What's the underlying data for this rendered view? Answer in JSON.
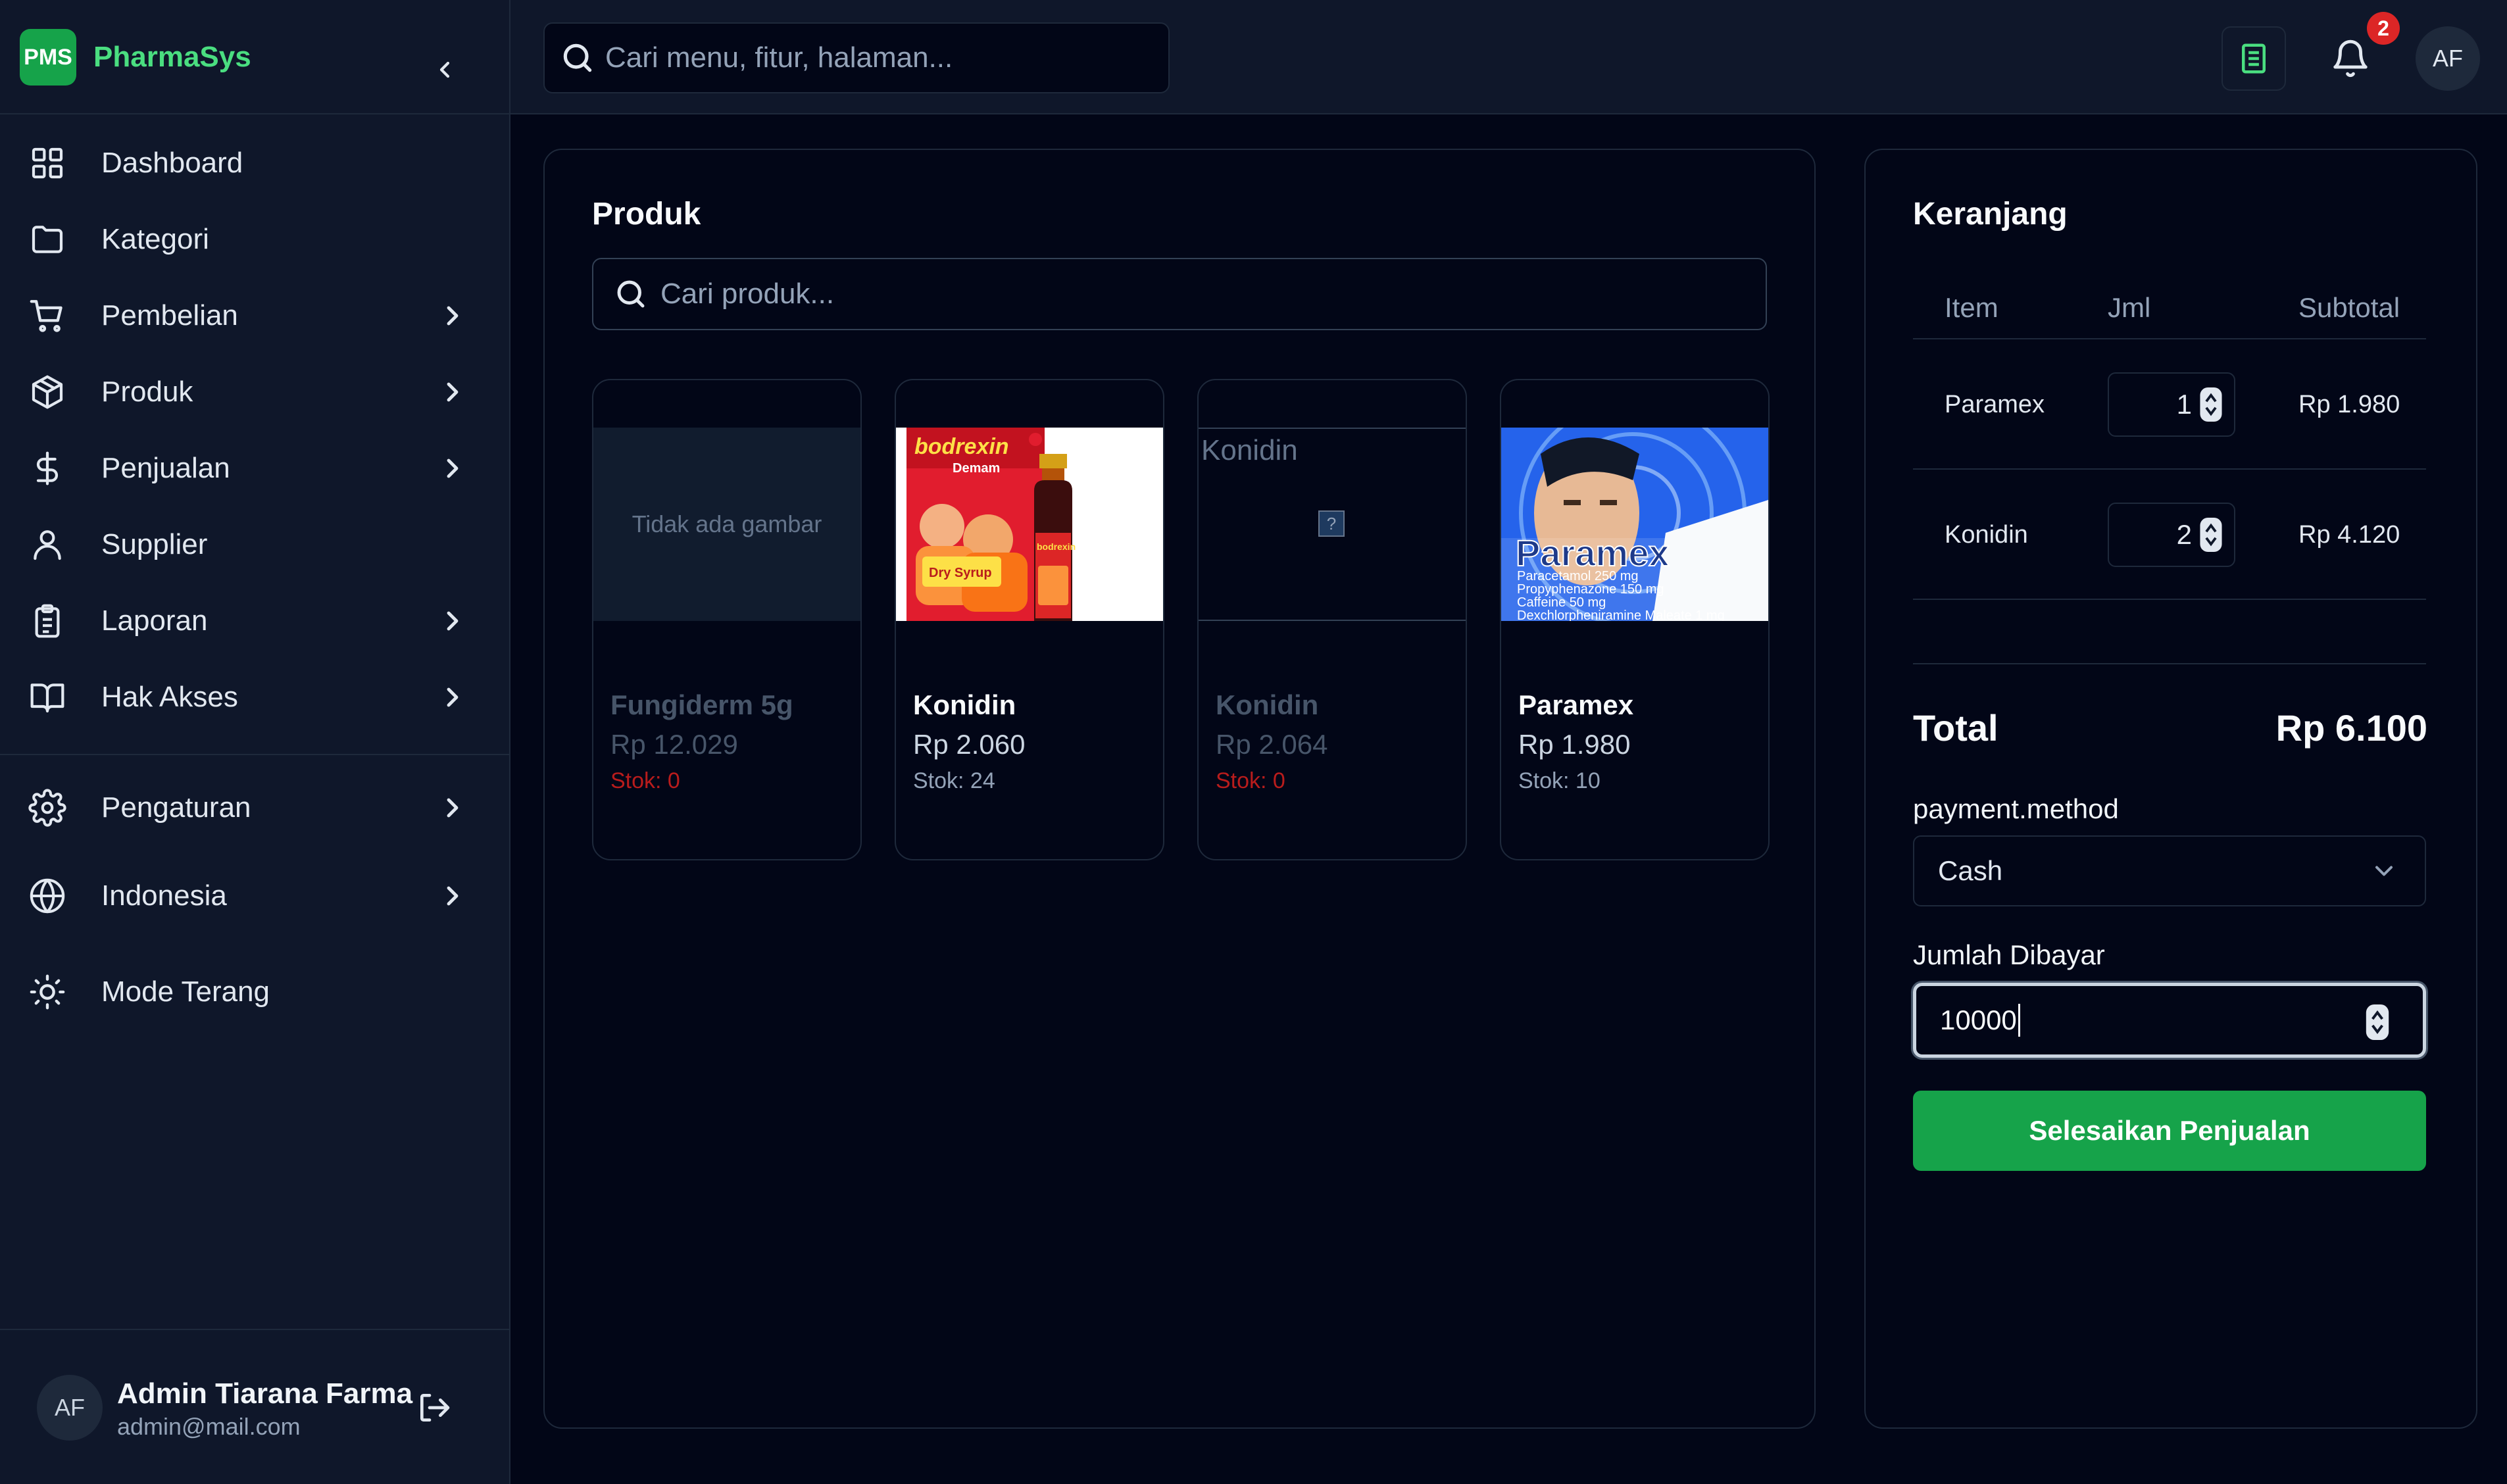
{
  "brand": {
    "logo": "PMS",
    "name": "PharmaSys"
  },
  "sidebar": {
    "items": [
      {
        "label": "Dashboard",
        "icon": "grid-icon",
        "has_submenu": false
      },
      {
        "label": "Kategori",
        "icon": "folder-icon",
        "has_submenu": false
      },
      {
        "label": "Pembelian",
        "icon": "cart-icon",
        "has_submenu": true
      },
      {
        "label": "Produk",
        "icon": "box-icon",
        "has_submenu": true
      },
      {
        "label": "Penjualan",
        "icon": "dollar-icon",
        "has_submenu": true
      },
      {
        "label": "Supplier",
        "icon": "user-icon",
        "has_submenu": false
      },
      {
        "label": "Laporan",
        "icon": "clipboard-icon",
        "has_submenu": true
      },
      {
        "label": "Hak Akses",
        "icon": "book-icon",
        "has_submenu": true
      }
    ],
    "settings": [
      {
        "label": "Pengaturan",
        "icon": "gear-icon",
        "has_submenu": true
      },
      {
        "label": "Indonesia",
        "icon": "globe-icon",
        "has_submenu": true
      },
      {
        "label": "Mode Terang",
        "icon": "sun-icon",
        "has_submenu": false
      }
    ],
    "user": {
      "initials": "AF",
      "name": "Admin Tiarana Farma",
      "email": "admin@mail.com"
    }
  },
  "topbar": {
    "search_placeholder": "Cari menu, fitur, halaman...",
    "notification_count": "2",
    "avatar_initials": "AF"
  },
  "products": {
    "title": "Produk",
    "search_placeholder": "Cari produk...",
    "items": [
      {
        "name": "Fungiderm 5g",
        "price": "Rp 12.029",
        "stock": "Stok: 0",
        "image": "none",
        "image_text": "Tidak ada gambar",
        "available": false
      },
      {
        "name": "Konidin",
        "price": "Rp 2.060",
        "stock": "Stok: 24",
        "image": "bodrexin-photo",
        "image_text": "",
        "available": true
      },
      {
        "name": "Konidin",
        "price": "Rp 2.064",
        "stock": "Stok: 0",
        "image": "broken",
        "image_text": "Konidin",
        "available": false
      },
      {
        "name": "Paramex",
        "price": "Rp 1.980",
        "stock": "Stok: 10",
        "image": "paramex-photo",
        "image_text": "",
        "available": true
      }
    ]
  },
  "cart": {
    "title": "Keranjang",
    "columns": {
      "item": "Item",
      "qty": "Jml",
      "subtotal": "Subtotal"
    },
    "rows": [
      {
        "item": "Paramex",
        "qty": "1",
        "subtotal": "Rp 1.980"
      },
      {
        "item": "Konidin",
        "qty": "2",
        "subtotal": "Rp 4.120"
      }
    ],
    "total_label": "Total",
    "total_value": "Rp 6.100",
    "payment_label": "payment.method",
    "payment_value": "Cash",
    "paid_label": "Jumlah Dibayar",
    "paid_value": "10000",
    "submit_label": "Selesaikan Penjualan"
  },
  "colors": {
    "accent": "#16a34a",
    "brand_text": "#4ade80",
    "danger": "#dc2626",
    "background": "#020617",
    "surface": "#0f172a"
  }
}
